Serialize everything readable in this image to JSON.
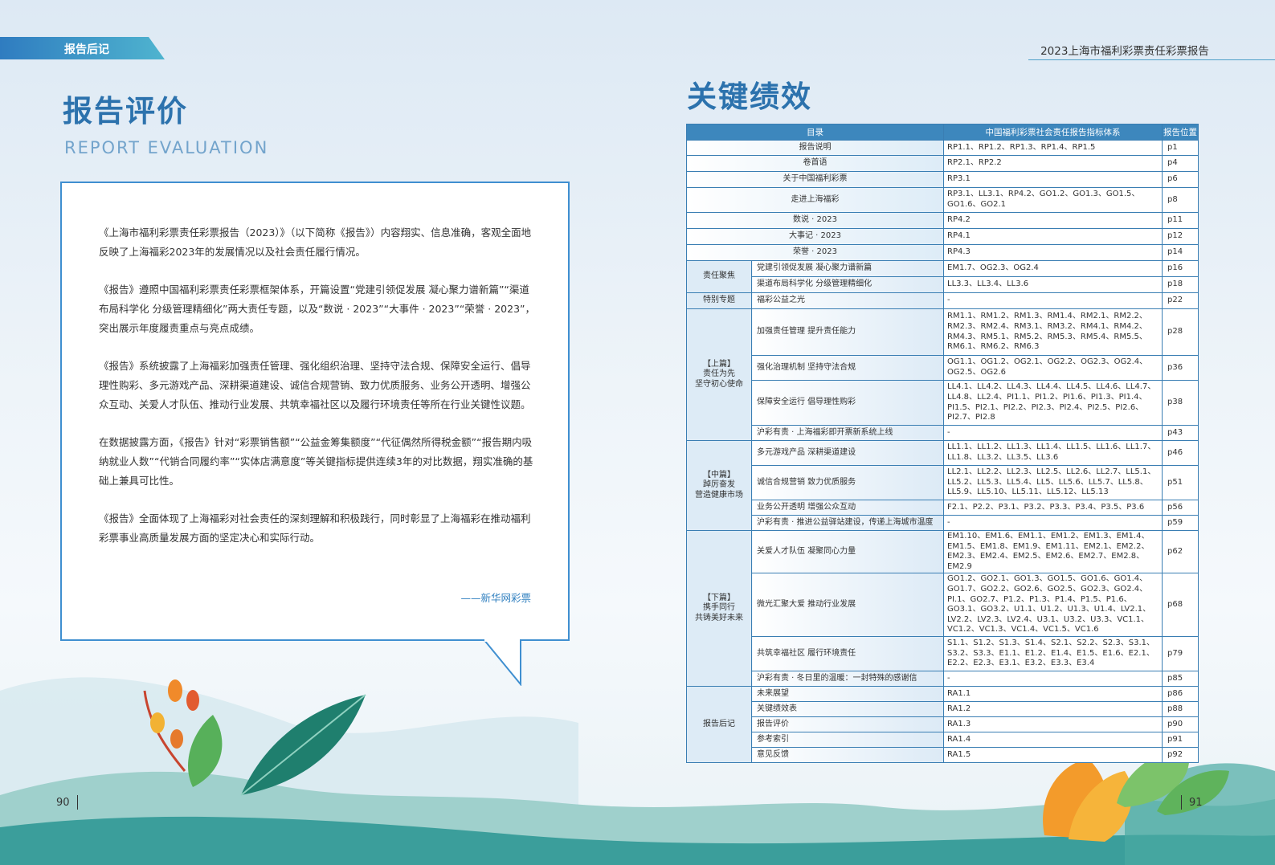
{
  "header": {
    "section_tab": "报告后记",
    "report_title": "2023上海市福利彩票责任彩票报告"
  },
  "left": {
    "title_cn": "报告评价",
    "title_en": "REPORT EVALUATION",
    "paragraphs": [
      "《上海市福利彩票责任彩票报告（2023）》（以下简称《报告》）内容翔实、信息准确，客观全面地反映了上海福彩2023年的发展情况以及社会责任履行情况。",
      "《报告》遵照中国福利彩票责任彩票框架体系，开篇设置“党建引领促发展 凝心聚力谱新篇”“渠道布局科学化 分级管理精细化”两大责任专题，以及“数说 · 2023”“大事件 · 2023”“荣誉 · 2023”，突出展示年度履责重点与亮点成绩。",
      "《报告》系统披露了上海福彩加强责任管理、强化组织治理、坚持守法合规、保障安全运行、倡导理性购彩、多元游戏产品、深耕渠道建设、诚信合规营销、致力优质服务、业务公开透明、增强公众互动、关爱人才队伍、推动行业发展、共筑幸福社区以及履行环境责任等所在行业关键性议题。",
      "在数据披露方面，《报告》针对“彩票销售额”“公益金筹集额度”“代征偶然所得税金额”“报告期内吸纳就业人数”“代销合同履约率”“实体店满意度”等关键指标提供连续3年的对比数据，翔实准确的基础上兼具可比性。",
      "《报告》全面体现了上海福彩对社会责任的深刻理解和积极践行，同时彰显了上海福彩在推动福利彩票事业高质量发展方面的坚定决心和实际行动。"
    ],
    "signature": "——新华网彩票",
    "page_number": "90"
  },
  "right": {
    "title": "关键绩效",
    "page_number": "91",
    "table": {
      "headers": [
        "目录",
        "中国福利彩票社会责任报告指标体系",
        "报告位置"
      ],
      "simple_rows": [
        {
          "label": "报告说明",
          "indicators": "RP1.1、RP1.2、RP1.3、RP1.4、RP1.5",
          "page": "p1"
        },
        {
          "label": "卷首语",
          "indicators": "RP2.1、RP2.2",
          "page": "p4"
        },
        {
          "label": "关于中国福利彩票",
          "indicators": "RP3.1",
          "page": "p6"
        },
        {
          "label": "走进上海福彩",
          "indicators": "RP3.1、LL3.1、RP4.2、GO1.2、GO1.3、GO1.5、GO1.6、GO2.1",
          "page": "p8"
        },
        {
          "label": "数说 · 2023",
          "indicators": "RP4.2",
          "page": "p11"
        },
        {
          "label": "大事记 · 2023",
          "indicators": "RP4.1",
          "page": "p12"
        },
        {
          "label": "荣誉 · 2023",
          "indicators": "RP4.3",
          "page": "p14"
        }
      ],
      "groups": [
        {
          "name": "责任聚焦",
          "rows": [
            {
              "label": "党建引领促发展 凝心聚力谱新篇",
              "indicators": "EM1.7、OG2.3、OG2.4",
              "page": "p16"
            },
            {
              "label": "渠道布局科学化 分级管理精细化",
              "indicators": "LL3.3、LL3.4、LL3.6",
              "page": "p18"
            }
          ]
        },
        {
          "name": "特别专题",
          "rows": [
            {
              "label": "福彩公益之光",
              "indicators": "-",
              "page": "p22"
            }
          ]
        },
        {
          "tag": "【上篇】",
          "line1": "责任为先",
          "line2": "坚守初心使命",
          "rows": [
            {
              "label": "加强责任管理 提升责任能力",
              "indicators": "RM1.1、RM1.2、RM1.3、RM1.4、RM2.1、RM2.2、RM2.3、RM2.4、RM3.1、RM3.2、RM4.1、RM4.2、RM4.3、RM5.1、RM5.2、RM5.3、RM5.4、RM5.5、RM6.1、RM6.2、RM6.3",
              "page": "p28"
            },
            {
              "label": "强化治理机制 坚持守法合规",
              "indicators": "OG1.1、OG1.2、OG2.1、OG2.2、OG2.3、OG2.4、OG2.5、OG2.6",
              "page": "p36"
            },
            {
              "label": "保障安全运行 倡导理性购彩",
              "indicators": "LL4.1、LL4.2、LL4.3、LL4.4、LL4.5、LL4.6、LL4.7、LL4.8、LL2.4、PI1.1、PI1.2、PI1.6、PI1.3、PI1.4、PI1.5、PI2.1、PI2.2、PI2.3、PI2.4、PI2.5、PI2.6、PI2.7、PI2.8",
              "page": "p38"
            },
            {
              "label": "沪彩有责 · 上海福彩即开票新系统上线",
              "indicators": "-",
              "page": "p43"
            }
          ]
        },
        {
          "tag": "【中篇】",
          "line1": "踔厉奋发",
          "line2": "营造健康市场",
          "rows": [
            {
              "label": "多元游戏产品 深耕渠道建设",
              "indicators": "LL1.1、LL1.2、LL1.3、LL1.4、LL1.5、LL1.6、LL1.7、LL1.8、LL3.2、LL3.5、LL3.6",
              "page": "p46"
            },
            {
              "label": "诚信合规营销 致力优质服务",
              "indicators": "LL2.1、LL2.2、LL2.3、LL2.5、LL2.6、LL2.7、LL5.1、LL5.2、LL5.3、LL5.4、LL5、LL5.6、LL5.7、LL5.8、LL5.9、LL5.10、LL5.11、LL5.12、LL5.13",
              "page": "p51"
            },
            {
              "label": "业务公开透明 增强公众互动",
              "indicators": "F2.1、P2.2、P3.1、P3.2、P3.3、P3.4、P3.5、P3.6",
              "page": "p56"
            },
            {
              "label": "沪彩有责 · 推进公益驿站建设，传递上海城市温度",
              "indicators": "-",
              "page": "p59"
            }
          ]
        },
        {
          "tag": "【下篇】",
          "line1": "携手同行",
          "line2": "共铸美好未来",
          "rows": [
            {
              "label": "关爱人才队伍 凝聚同心力量",
              "indicators": "EM1.10、EM1.6、EM1.1、EM1.2、EM1.3、EM1.4、EM1.5、EM1.8、EM1.9、EM1.11、EM2.1、EM2.2、EM2.3、EM2.4、EM2.5、EM2.6、EM2.7、EM2.8、EM2.9",
              "page": "p62"
            },
            {
              "label": "微光汇聚大爱 推动行业发展",
              "indicators": "GO1.2、GO2.1、GO1.3、GO1.5、GO1.6、GO1.4、GO1.7、GO2.2、GO2.6、GO2.5、GO2.3、GO2.4、PI.1、GO2.7、P1.2、P1.3、P1.4、P1.5、P1.6、GO3.1、GO3.2、U1.1、U1.2、U1.3、U1.4、LV2.1、LV2.2、LV2.3、LV2.4、U3.1、U3.2、U3.3、VC1.1、VC1.2、VC1.3、VC1.4、VC1.5、VC1.6",
              "page": "p68"
            },
            {
              "label": "共筑幸福社区 履行环境责任",
              "indicators": "S1.1、S1.2、S1.3、S1.4、S2.1、S2.2、S2.3、S3.1、S3.2、S3.3、E1.1、E1.2、E1.4、E1.5、E1.6、E2.1、E2.2、E2.3、E3.1、E3.2、E3.3、E3.4",
              "page": "p79"
            },
            {
              "label": "沪彩有责 · 冬日里的温暖：一封特殊的感谢信",
              "indicators": "-",
              "page": "p85"
            }
          ]
        },
        {
          "name": "报告后记",
          "rows": [
            {
              "label": "未来展望",
              "indicators": "RA1.1",
              "page": "p86"
            },
            {
              "label": "关键绩效表",
              "indicators": "RA1.2",
              "page": "p88"
            },
            {
              "label": "报告评价",
              "indicators": "RA1.3",
              "page": "p90"
            },
            {
              "label": "参考索引",
              "indicators": "RA1.4",
              "page": "p91"
            },
            {
              "label": "意见反馈",
              "indicators": "RA1.5",
              "page": "p92"
            }
          ]
        }
      ]
    }
  },
  "colors": {
    "brand_blue": "#2c72ad",
    "table_header": "#3d87bd",
    "red": "#d53636",
    "green": "#2f9a46",
    "light_blue": "#2b7ec3"
  }
}
